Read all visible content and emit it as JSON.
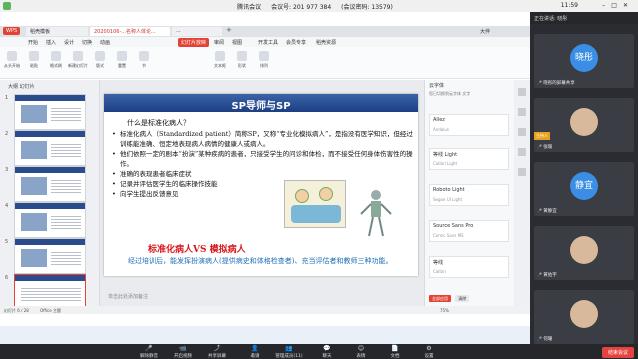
{
  "window": {
    "app": "腾讯会议",
    "meeting_label": "会议号: 201 977 384",
    "password_label": "(会议密码: 13579)",
    "clock": "11:59"
  },
  "wps": {
    "logo": "WPS",
    "tabs": [
      "稻壳模板",
      "20200106-...名称人体论...",
      "..."
    ],
    "user": "大伴",
    "ribbon_tabs": [
      "开始",
      "插入",
      "设计",
      "切换",
      "动画",
      "幻灯片放映",
      "审阅",
      "视图",
      "开发工具",
      "会员专享",
      "稻壳资源"
    ],
    "ribbon_buttons": [
      "从头开始",
      "粘贴",
      "格式刷",
      "新建幻灯片",
      "版式",
      "重置",
      "节",
      "文本框",
      "形状",
      "排列"
    ],
    "thumbs_header": "大纲 幻灯片",
    "slide_numbers": [
      "1",
      "2",
      "3",
      "4",
      "5",
      "6"
    ],
    "status": {
      "slide": "幻灯片 6 / 28",
      "theme": "Office 主题",
      "notes": "单击此处添加备注",
      "zoom": "75%"
    }
  },
  "slide": {
    "title": "SP导师与SP",
    "question": "什么是标准化病人？",
    "bullets": [
      "标准化病人（Standardized patient）简称SP，又称“专业化模拟病人”，是指没有医学知识，但经过训练能准确、恒定地表现病人病情的健康人或病人。",
      "他们依照一定的剧本“扮演”某种疾病的患者，只接受学生的问诊和体检，而不接受任何身体伤害性的操作。",
      "准确的表现患者临床症状",
      "记录并评估医学生的临床操作技能",
      "向学生提出反馈意见"
    ],
    "vs_title": "标准化病人VS 模拟病人",
    "para": "经过培训后，能发挥扮演病人(提供病史和体格检查者)、充当评估者和教师三种功能。"
  },
  "fonts_panel": {
    "header": "云字体",
    "tip": "您已切换到云字体 文字",
    "fonts": [
      {
        "name": "Allez",
        "sub": "Andalus"
      },
      {
        "name": "等线 Light",
        "sub": "Calibri Light"
      },
      {
        "name": "Roboto Light",
        "sub": "Segoe UI Light"
      },
      {
        "name": "Source Sans Pro",
        "sub": "Comic Sans MS"
      },
      {
        "name": "等线",
        "sub": "Calibri"
      }
    ],
    "apply": "全部应用",
    "clear": "清除"
  },
  "panel": {
    "speaking": "正在讲话: 晓彤",
    "tiles": [
      {
        "avatar": "晓彤",
        "name": "晓彤的屏幕共享",
        "host": ""
      },
      {
        "avatar": "",
        "name": "张瑜",
        "host": "主持人"
      },
      {
        "avatar": "静宜",
        "name": "黄静宜",
        "host": ""
      },
      {
        "avatar": "",
        "name": "黄佑宇",
        "host": ""
      },
      {
        "avatar": "",
        "name": "何珊",
        "host": ""
      }
    ]
  },
  "toolbar": {
    "buttons": [
      {
        "icon": "🎤",
        "label": "解除静音"
      },
      {
        "icon": "📹",
        "label": "开启视频"
      },
      {
        "icon": "⤴",
        "label": "共享屏幕"
      },
      {
        "icon": "👤",
        "label": "邀请"
      },
      {
        "icon": "👥",
        "label": "管理成员(11)"
      },
      {
        "icon": "💬",
        "label": "聊天"
      },
      {
        "icon": "😊",
        "label": "表情"
      },
      {
        "icon": "📄",
        "label": "文档"
      },
      {
        "icon": "⚙",
        "label": "设置"
      }
    ],
    "end": "结束会议"
  }
}
